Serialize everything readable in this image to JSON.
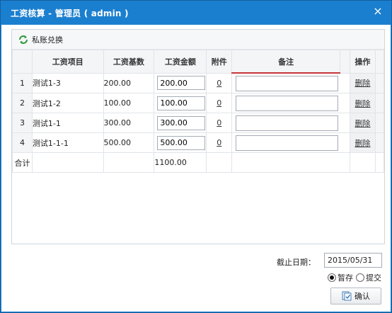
{
  "window": {
    "title": "工资核算 - 管理员 ( admin )",
    "close_label": "×"
  },
  "toolbar": {
    "exchange_label": "私账兑换",
    "exchange_icon": "refresh-icon"
  },
  "table": {
    "columns": [
      "",
      "工资项目",
      "工资基数",
      "工资金额",
      "附件",
      "备注",
      "操作"
    ],
    "rows": [
      {
        "idx": "1",
        "item": "测试1-3",
        "base": "200.00",
        "amount": "200.00",
        "attach": "0",
        "note": "",
        "op": "删除"
      },
      {
        "idx": "2",
        "item": "测试1-2",
        "base": "100.00",
        "amount": "100.00",
        "attach": "0",
        "note": "",
        "op": "删除"
      },
      {
        "idx": "3",
        "item": "测试1-1",
        "base": "300.00",
        "amount": "300.00",
        "attach": "0",
        "note": "",
        "op": "删除"
      },
      {
        "idx": "4",
        "item": "测试1-1-1",
        "base": "500.00",
        "amount": "500.00",
        "attach": "0",
        "note": "",
        "op": "删除"
      }
    ],
    "total": {
      "label": "合计",
      "amount": "1100.00"
    }
  },
  "footer": {
    "deadline_label": "截止日期：",
    "deadline_value": "2015/05/31",
    "radio_draft": "暂存",
    "radio_submit": "提交",
    "selected": "暂存",
    "confirm_label": "确认"
  },
  "colors": {
    "titlebar": "#1b7fcf",
    "notes_header_accent": "#c8363a"
  }
}
